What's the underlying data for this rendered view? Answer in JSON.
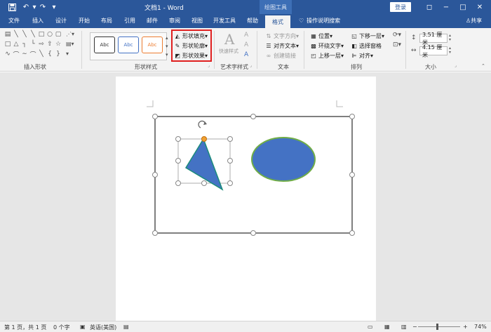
{
  "titlebar": {
    "save_icon": "save-icon",
    "undo_icon": "undo-icon",
    "redo_icon": "redo-icon",
    "customize_icon": "customize-qat-icon",
    "title": "文档1 - Word",
    "context_tab": "绘图工具",
    "login": "登录",
    "minimize": "−",
    "restore": "◻",
    "maximize": "□",
    "close": "✕"
  },
  "tabs": [
    "文件",
    "插入",
    "设计",
    "开始",
    "布局",
    "引用",
    "邮件",
    "审阅",
    "视图",
    "开发工具",
    "帮助"
  ],
  "active_tab": "格式",
  "tell_me": "操作说明搜索",
  "share": "共享",
  "ribbon": {
    "groups": {
      "insert_shapes": "插入形状",
      "shape_styles": "形状样式",
      "wordart_styles": "艺术字样式",
      "text": "文本",
      "arrange": "排列",
      "size": "大小"
    },
    "style_samples": [
      "Abc",
      "Abc",
      "Abc"
    ],
    "shape_fill": "形状填充",
    "shape_outline": "形状轮廓",
    "shape_effects": "形状效果",
    "quick_styles": "快速样式",
    "text_direction": "文字方向",
    "align_text": "对齐文本",
    "create_link": "创建链接",
    "position": "位置",
    "wrap_text": "环绕文字",
    "bring_forward": "上移一层",
    "send_backward": "下移一层",
    "selection_pane": "选择窗格",
    "align": "对齐",
    "height": "3.51 厘米",
    "width": "4.15 厘米"
  },
  "statusbar": {
    "page": "第 1 页，共 1 页",
    "words": "0 个字",
    "language": "英语(美国)",
    "zoom": "74%"
  },
  "colors": {
    "accent": "#2b579a",
    "shape_fill": "#4472c4",
    "ellipse_outline": "#70ad47",
    "triangle_outline": "#1b8c7b",
    "highlight_box": "#e02020",
    "rotate_handle": "#f0a030"
  }
}
